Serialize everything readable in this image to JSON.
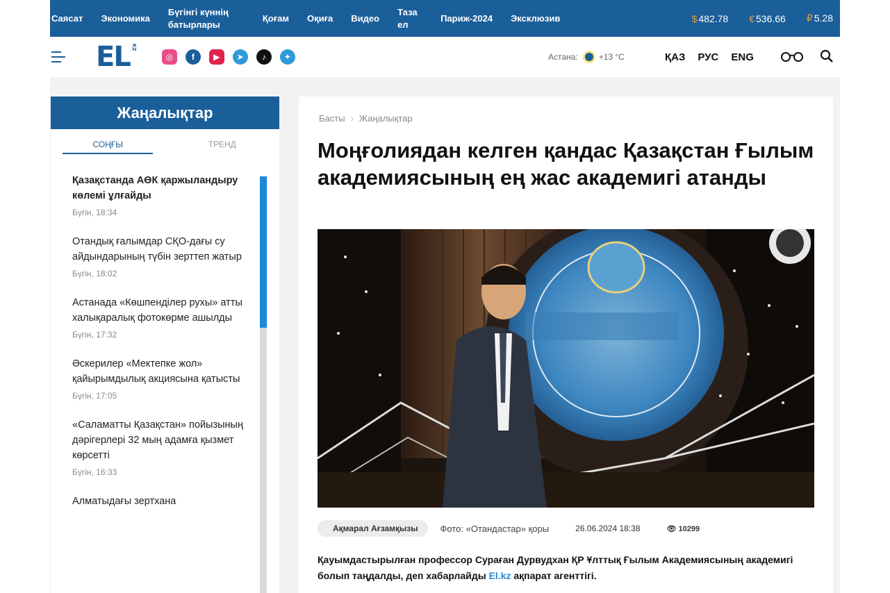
{
  "topnav": {
    "items": [
      "Саясат",
      "Экономика",
      "Бүгінгі күннің батырлары",
      "Қоғам",
      "Оқиға",
      "Видео",
      "Таза ел",
      "Париж-2024",
      "Эксклюзив"
    ],
    "rates": [
      {
        "symbol": "$",
        "value": "482.78"
      },
      {
        "symbol": "€",
        "value": "536.66"
      },
      {
        "symbol": "₽",
        "value": "5.28"
      }
    ]
  },
  "header": {
    "logo": "EL",
    "logo_sub": "KZ",
    "socials": [
      "instagram-icon",
      "facebook-icon",
      "youtube-icon",
      "telegram-icon",
      "tiktok-icon",
      "twitter-icon"
    ],
    "weather_city": "Астана:",
    "weather_temp": "+13 °C",
    "langs": [
      "ҚАЗ",
      "РУС",
      "ENG"
    ]
  },
  "sidebar": {
    "title": "Жаңалықтар",
    "tabs": [
      "СОҢҒЫ",
      "ТРЕНД"
    ],
    "news": [
      {
        "title": "Қазақстанда АӨК қаржыландыру көлемі ұлғайды",
        "time": "Бүгін, 18:34",
        "bold": true
      },
      {
        "title": "Отандық ғалымдар СҚО-дағы су айдындарының түбін зерттеп жатыр",
        "time": "Бүгін, 18:02",
        "bold": false
      },
      {
        "title": "Астанада «Көшпенділер рухы» атты халықаралық фотокөрме ашылды",
        "time": "Бүгін, 17:32",
        "bold": false
      },
      {
        "title": "Әскерилер «Мектепке жол» қайырымдылық акциясына қатысты",
        "time": "Бүгін, 17:05",
        "bold": false
      },
      {
        "title": "«Саламатты Қазақстан» пойызының дәрігерлері 32 мың адамға қызмет көрсетті",
        "time": "Бүгін, 16:33",
        "bold": false
      },
      {
        "title": "Алматыдағы зертхана",
        "time": "",
        "bold": false
      }
    ]
  },
  "article": {
    "breadcrumb": [
      "Басты",
      "Жаңалықтар"
    ],
    "title": "Моңғолиядан келген қандас Қазақстан Ғылым академиясының ең жас академигі атанды",
    "author": "Ақмарал Ағзамқызы",
    "photo_credit": "Фото: «Отандастар» қоры",
    "date": "26.06.2024 18:38",
    "views": "10299",
    "lead_before": "Қауымдастырылған профессор Сураған Дурвудхан ҚР Ұлттық Ғылым Академиясының академигі болып таңдалды, деп хабарлайды ",
    "lead_link": "El.kz",
    "lead_after": " ақпарат агенттігі."
  }
}
